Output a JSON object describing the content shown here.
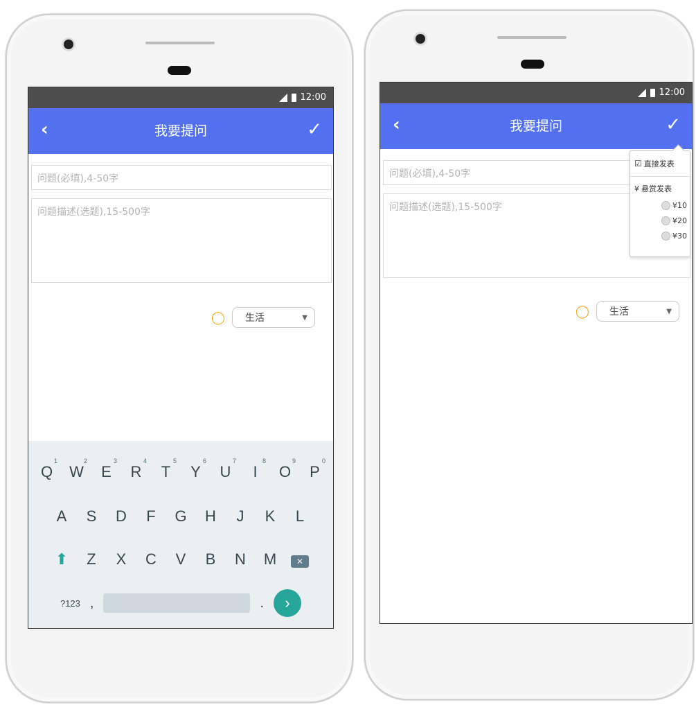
{
  "status_time": "12:00",
  "appbar": {
    "back_icon": "chevron-left-icon",
    "title": "我要提问",
    "confirm_icon": "checkmark-icon"
  },
  "form": {
    "question_placeholder": "问题(必填),4-50字",
    "description_placeholder": "问题描述(选题),15-500字",
    "category_value": "生活",
    "tag_icon": "tag-icon"
  },
  "keyboard": {
    "row1": [
      {
        "key": "Q",
        "hint": "1"
      },
      {
        "key": "W",
        "hint": "2"
      },
      {
        "key": "E",
        "hint": "3"
      },
      {
        "key": "R",
        "hint": "4"
      },
      {
        "key": "T",
        "hint": "5"
      },
      {
        "key": "Y",
        "hint": "6"
      },
      {
        "key": "U",
        "hint": "7"
      },
      {
        "key": "I",
        "hint": "8"
      },
      {
        "key": "O",
        "hint": "9"
      },
      {
        "key": "P",
        "hint": "0"
      }
    ],
    "row2": [
      "A",
      "S",
      "D",
      "F",
      "G",
      "H",
      "J",
      "K",
      "L"
    ],
    "row3": [
      "Z",
      "X",
      "C",
      "V",
      "B",
      "N",
      "M"
    ],
    "symbols_label": "?123",
    "comma_label": ",",
    "period_label": ".",
    "colors": {
      "accent": "#26a69a",
      "background": "#eceff1"
    }
  },
  "publish_menu": {
    "direct_publish": "直接发表",
    "reward_publish_symbol": "¥",
    "reward_publish": "悬赏发表",
    "reward_options": [
      "¥10",
      "¥20",
      "¥30"
    ]
  },
  "colors": {
    "appbar": "#5270f0",
    "statusbar": "#4d4d4d",
    "tag": "#f5a623"
  }
}
